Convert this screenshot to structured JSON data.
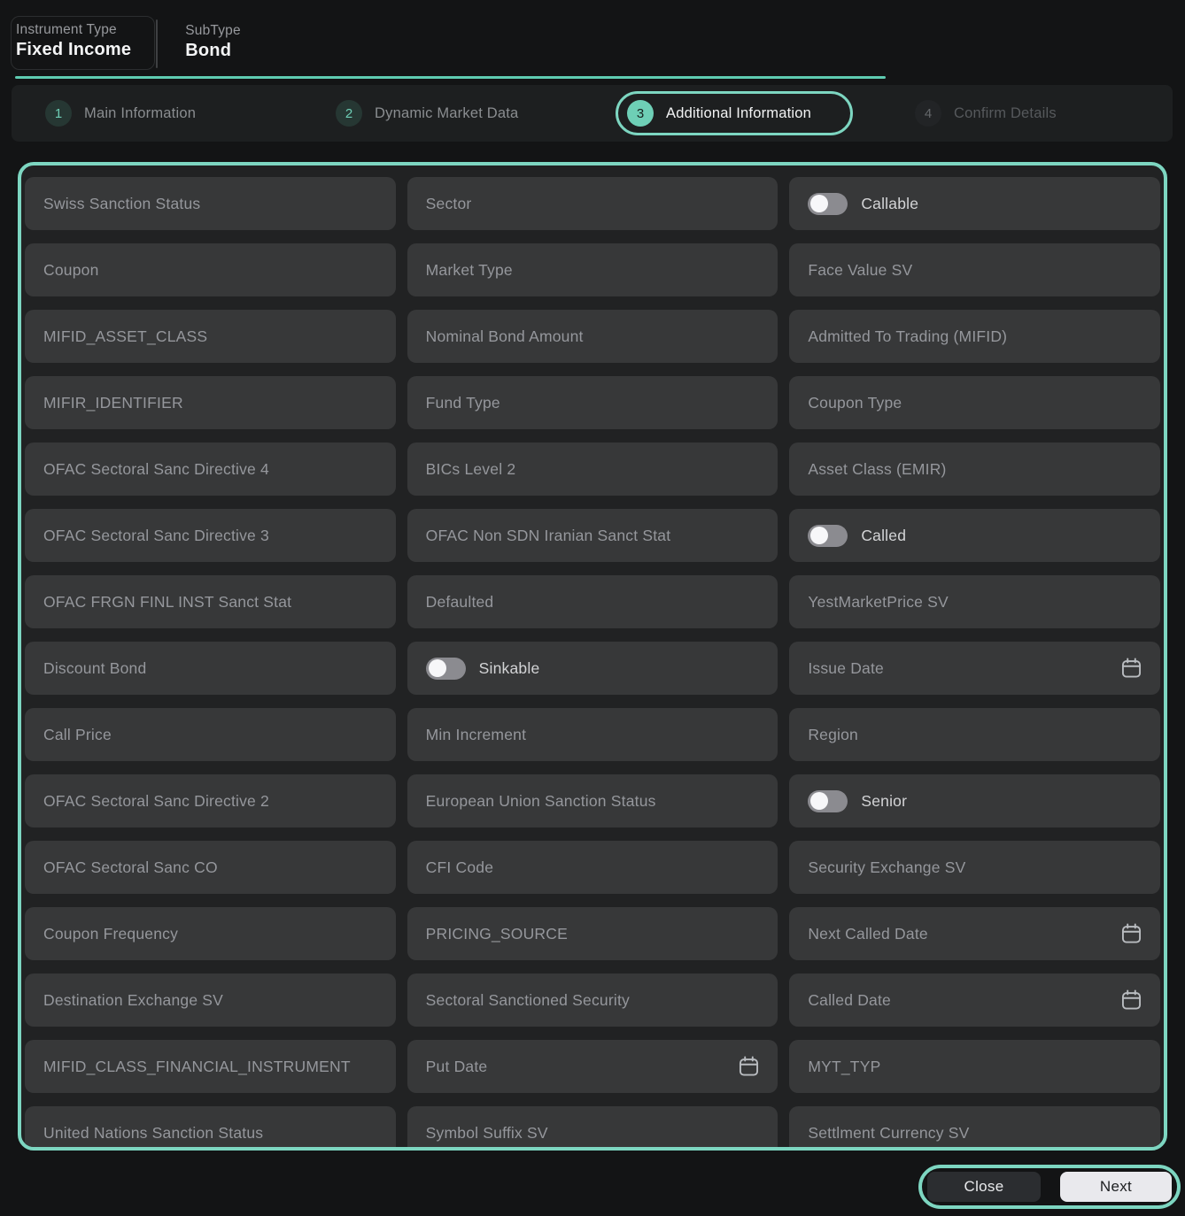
{
  "header": {
    "instrument_type_label": "Instrument Type",
    "instrument_type_value": "Fixed Income",
    "subtype_label": "SubType",
    "subtype_value": "Bond"
  },
  "stepper": {
    "steps": [
      {
        "number": "1",
        "label": "Main Information",
        "state": "done"
      },
      {
        "number": "2",
        "label": "Dynamic Market Data",
        "state": "done"
      },
      {
        "number": "3",
        "label": "Additional Information",
        "state": "active"
      },
      {
        "number": "4",
        "label": "Confirm Details",
        "state": "upcoming"
      }
    ]
  },
  "form": {
    "fields": [
      {
        "label": "Swiss Sanction Status",
        "type": "text"
      },
      {
        "label": "Sector",
        "type": "text"
      },
      {
        "label": "Callable",
        "type": "toggle",
        "value": "off"
      },
      {
        "label": "Coupon",
        "type": "text"
      },
      {
        "label": "Market Type",
        "type": "text"
      },
      {
        "label": "Face Value SV",
        "type": "text"
      },
      {
        "label": "MIFID_ASSET_CLASS",
        "type": "text"
      },
      {
        "label": "Nominal Bond Amount",
        "type": "text"
      },
      {
        "label": "Admitted To Trading (MIFID)",
        "type": "text"
      },
      {
        "label": "MIFIR_IDENTIFIER",
        "type": "text"
      },
      {
        "label": "Fund Type",
        "type": "text"
      },
      {
        "label": "Coupon Type",
        "type": "text"
      },
      {
        "label": "OFAC Sectoral Sanc Directive 4",
        "type": "text"
      },
      {
        "label": "BICs Level 2",
        "type": "text"
      },
      {
        "label": "Asset Class (EMIR)",
        "type": "text"
      },
      {
        "label": "OFAC Sectoral Sanc Directive 3",
        "type": "text"
      },
      {
        "label": "OFAC Non SDN Iranian Sanct Stat",
        "type": "text"
      },
      {
        "label": "Called",
        "type": "toggle",
        "value": "off"
      },
      {
        "label": "OFAC FRGN FINL INST Sanct Stat",
        "type": "text"
      },
      {
        "label": "Defaulted",
        "type": "text"
      },
      {
        "label": "YestMarketPrice SV",
        "type": "text"
      },
      {
        "label": "Discount Bond",
        "type": "text"
      },
      {
        "label": "Sinkable",
        "type": "toggle",
        "value": "off"
      },
      {
        "label": "Issue Date",
        "type": "date"
      },
      {
        "label": "Call Price",
        "type": "text"
      },
      {
        "label": "Min Increment",
        "type": "text"
      },
      {
        "label": "Region",
        "type": "text"
      },
      {
        "label": "OFAC Sectoral Sanc Directive 2",
        "type": "text"
      },
      {
        "label": "European Union Sanction Status",
        "type": "text"
      },
      {
        "label": "Senior",
        "type": "toggle",
        "value": "off"
      },
      {
        "label": "OFAC Sectoral Sanc CO",
        "type": "text"
      },
      {
        "label": "CFI Code",
        "type": "text"
      },
      {
        "label": "Security Exchange SV",
        "type": "text"
      },
      {
        "label": "Coupon Frequency",
        "type": "text"
      },
      {
        "label": "PRICING_SOURCE",
        "type": "text"
      },
      {
        "label": "Next Called Date",
        "type": "date"
      },
      {
        "label": "Destination Exchange SV",
        "type": "text"
      },
      {
        "label": "Sectoral Sanctioned Security",
        "type": "text"
      },
      {
        "label": "Called Date",
        "type": "date"
      },
      {
        "label": "MIFID_CLASS_FINANCIAL_INSTRUMENT",
        "type": "text"
      },
      {
        "label": "Put Date",
        "type": "date"
      },
      {
        "label": "MYT_TYP",
        "type": "text"
      },
      {
        "label": "United Nations Sanction Status",
        "type": "text"
      },
      {
        "label": "Symbol Suffix SV",
        "type": "text"
      },
      {
        "label": "Settlment Currency SV",
        "type": "text"
      }
    ]
  },
  "footer": {
    "close_label": "Close",
    "next_label": "Next"
  },
  "colors": {
    "accent_teal": "#6ecfb6",
    "annotation_ring": "#7dd6c1",
    "progress_underline": "#5ecbb1",
    "page_bg": "#131415",
    "stepper_bg": "#1d1f20",
    "panel_bg": "#212223",
    "field_bg": "#373839",
    "placeholder_text": "#95979c",
    "toggle_track": "#8b8b90",
    "toggle_knob": "#f7f7f9",
    "close_button_bg": "#2b2d30",
    "next_button_bg": "#e9e9ed"
  }
}
